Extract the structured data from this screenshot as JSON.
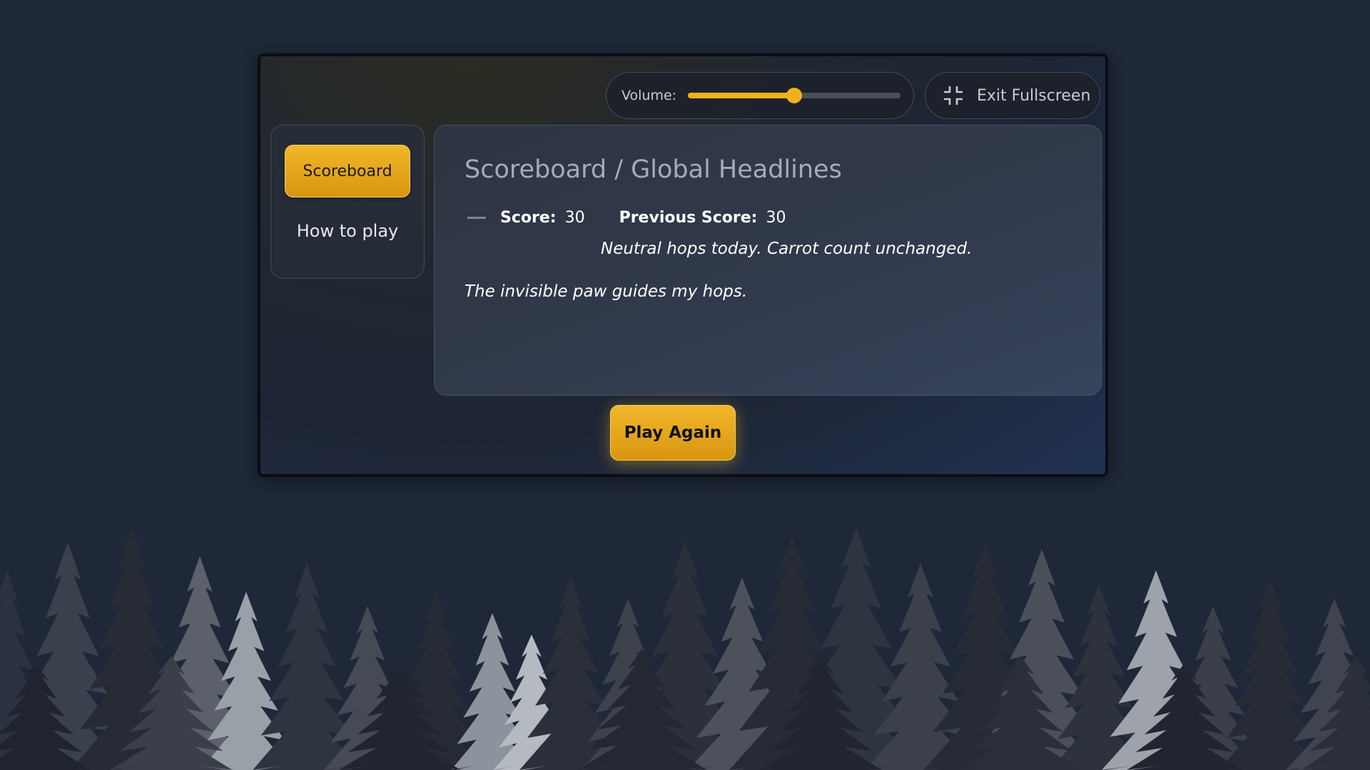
{
  "controls": {
    "volume_label": "Volume:",
    "volume_level": 0.5,
    "fullscreen_label": "Exit Fullscreen"
  },
  "sidebar": {
    "items": [
      {
        "label": "Scoreboard",
        "active": true
      },
      {
        "label": "How to play",
        "active": false
      }
    ]
  },
  "panel": {
    "title": "Scoreboard / Global Headlines",
    "score_label": "Score:",
    "score_value": "30",
    "previous_label": "Previous Score:",
    "previous_value": "30",
    "trend": "neutral",
    "headline": "Neutral hops today. Carrot count unchanged.",
    "quote": "The invisible paw guides my hops."
  },
  "actions": {
    "play_again_label": "Play Again"
  },
  "colors": {
    "accent": "#f0b21c",
    "background": "#1e2838"
  },
  "icons": [
    "exit-fullscreen-icon",
    "neutral-trend-icon"
  ]
}
